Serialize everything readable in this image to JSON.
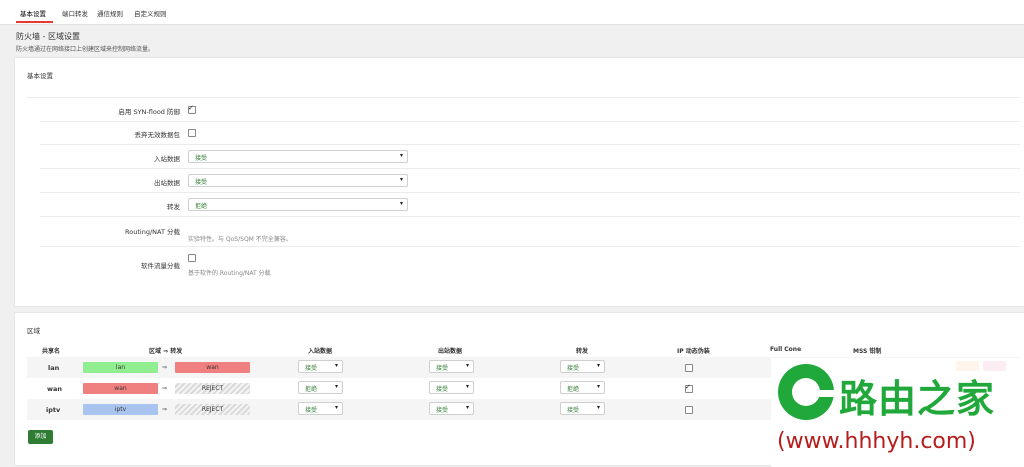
{
  "tabs": [
    "基本设置",
    "端口转发",
    "通信规则",
    "自定义规则"
  ],
  "page": {
    "title": "防火墙 - 区域设置",
    "description": "防火墙通过在网络接口上创建区域来控制网络流量。"
  },
  "basic": {
    "heading": "基本设置",
    "syn_flood_label": "启用 SYN-flood 防御",
    "syn_flood_checked": true,
    "drop_invalid_label": "丢弃无效数据包",
    "drop_invalid_checked": false,
    "input_label": "入站数据",
    "input_value": "接受",
    "output_label": "出站数据",
    "output_value": "接受",
    "forward_label": "转发",
    "forward_value": "拒绝",
    "routing_label": "Routing/NAT 分载",
    "routing_hint": "实验特性。与 QoS/SQM 不完全兼容。",
    "software_label": "软件流量分载",
    "software_hint": "基于软件的 Routing/NAT 分载"
  },
  "zones": {
    "heading": "区域",
    "columns": [
      "共享名",
      "区域 ⇒ 转发",
      "入站数据",
      "出站数据",
      "转发",
      "IP 动态伪装",
      "Full Cone",
      "MSS 钳制"
    ],
    "rows": [
      {
        "name": "lan",
        "zone": "lan",
        "zone_color": "#90ee90",
        "forward": "wan",
        "forward_color": "#f08080",
        "forward_type": "zone",
        "input": "接受",
        "output": "接受",
        "fwd": "接受",
        "masq": false
      },
      {
        "name": "wan",
        "zone": "wan",
        "zone_color": "#f08080",
        "forward": "REJECT",
        "forward_color": "",
        "forward_type": "reject",
        "input": "拒绝",
        "output": "接受",
        "fwd": "拒绝",
        "masq": true
      },
      {
        "name": "iptv",
        "zone": "iptv",
        "zone_color": "#aac4f0",
        "forward": "REJECT",
        "forward_color": "",
        "forward_type": "reject",
        "input": "接受",
        "output": "接受",
        "fwd": "接受",
        "masq": false
      }
    ],
    "add_label": "添加",
    "action_colors": [
      "#f57c00",
      "#d81b60"
    ]
  },
  "watermark": {
    "title": "路由之家",
    "url": "(www.hhhyh.com)"
  }
}
